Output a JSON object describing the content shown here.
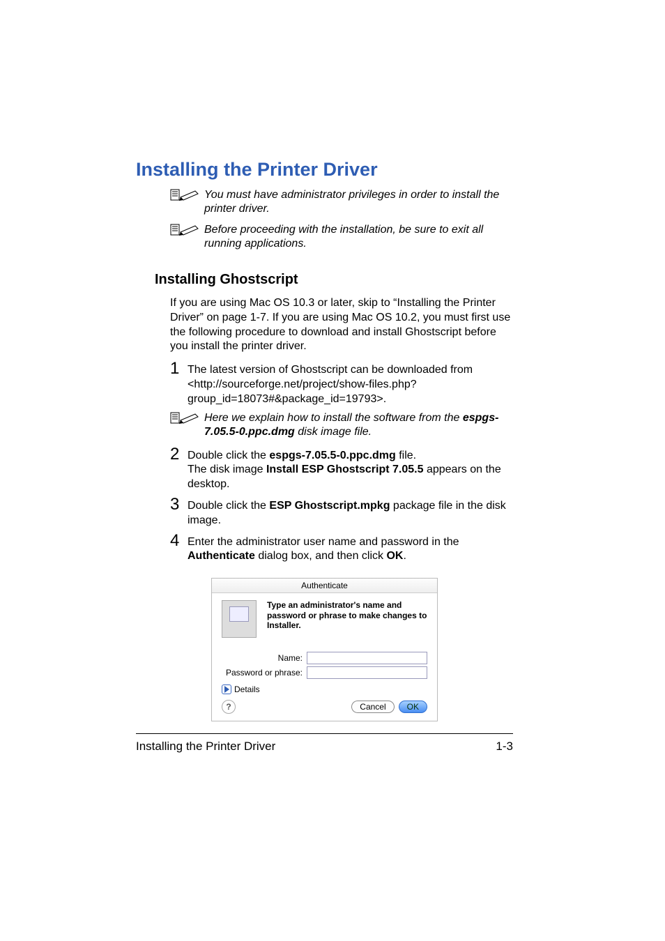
{
  "title_main": "Installing the Printer Driver",
  "note1": "You must have administrator privileges in order to install the printer driver.",
  "note2": "Before proceeding with the installation, be sure to exit all running applications.",
  "sub_title": "Installing Ghostscript",
  "para1": "If you are using Mac OS 10.3 or later, skip to “Installing the Printer Driver” on page 1-7. If you are using Mac OS 10.2, you must first use the following procedure to download and install Ghostscript before you install the printer driver.",
  "step1_a": "The latest version of Ghostscript can be downloaded from <http://sourceforge.net/project/show-files.php?group_id=18073#&package_id=19793>.",
  "note3_a": "Here we explain how to install the software from the ",
  "note3_b_file": "espgs-7.05.5-0.ppc.dmg",
  "note3_c": " disk image file.",
  "step2_a": "Double click the ",
  "step2_file": "espgs-7.05.5-0.ppc.dmg",
  "step2_b": " file.",
  "step2_c1": "The disk image ",
  "step2_c_bold": "Install ESP Ghostscript 7.05.5",
  "step2_c2": " appears on the desktop.",
  "step3_a": "Double click the ",
  "step3_file": "ESP Ghostscript.mpkg",
  "step3_b": " package file in the disk image.",
  "step4_a": "Enter the administrator user name and password in the ",
  "step4_bold": "Authenticate",
  "step4_b": " dialog box, and then click ",
  "step4_ok": "OK",
  "step4_c": ".",
  "dialog": {
    "title": "Authenticate",
    "prompt": "Type an administrator's name and password or phrase to make changes to Installer.",
    "name_label": "Name:",
    "pass_label": "Password or phrase:",
    "details": "Details",
    "help": "?",
    "cancel": "Cancel",
    "ok": "OK"
  },
  "footer_left": "Installing the Printer Driver",
  "footer_right": "1-3"
}
